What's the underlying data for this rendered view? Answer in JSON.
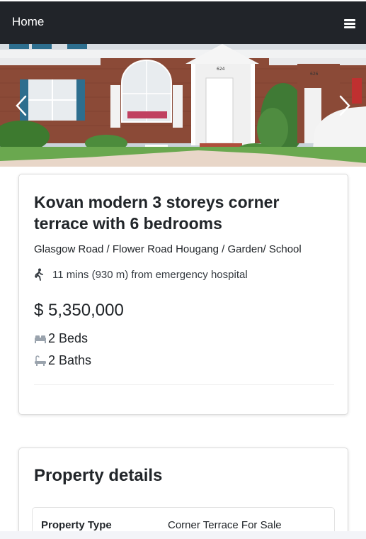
{
  "navbar": {
    "home_label": "Home",
    "menu_icon": "hamburger-menu-icon",
    "background": "#212429"
  },
  "carousel": {
    "prev_icon": "chevron-left-icon",
    "next_icon": "chevron-right-icon",
    "house_number_left": "624",
    "house_number_right": "626",
    "active_slide": 1
  },
  "listing": {
    "title": "Kovan modern 3 storeys corner terrace with 6 bedrooms",
    "address": "Glasgow Road / Flower Road Hougang / Garden/ School",
    "walk_icon": "walking-person-icon",
    "walk_text": "11 mins (930 m) from emergency hospital",
    "price": "$ 5,350,000",
    "beds_icon": "bed-icon",
    "beds": "2 Beds",
    "baths_icon": "bathtub-icon",
    "baths": "2 Baths"
  },
  "property_details": {
    "heading": "Property details",
    "rows": [
      {
        "label": "Property Type",
        "value": "Corner Terrace For Sale"
      }
    ]
  }
}
